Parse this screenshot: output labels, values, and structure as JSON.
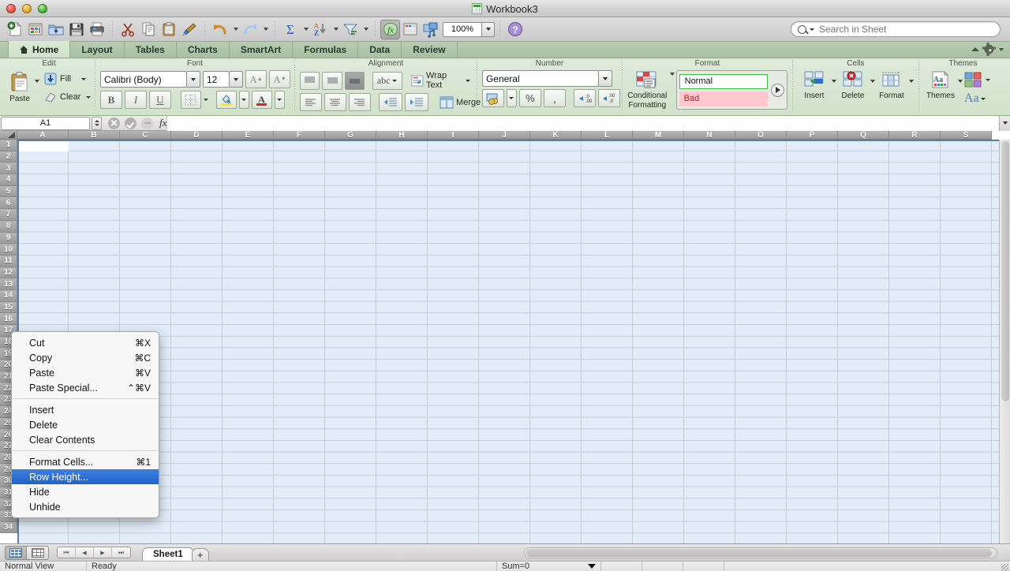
{
  "window": {
    "title": "Workbook3",
    "traffic_lights": [
      "close",
      "minimize",
      "zoom"
    ]
  },
  "standard_toolbar": {
    "buttons": [
      {
        "name": "new-workbook",
        "icon": "new-document-icon"
      },
      {
        "name": "open-template",
        "icon": "template-gallery-icon"
      },
      {
        "name": "open",
        "icon": "open-folder-icon"
      },
      {
        "name": "save",
        "icon": "save-disk-icon"
      },
      {
        "name": "print",
        "icon": "printer-icon"
      },
      {
        "name": "cut",
        "icon": "scissors-icon"
      },
      {
        "name": "copy",
        "icon": "copy-icon"
      },
      {
        "name": "paste",
        "icon": "clipboard-icon"
      },
      {
        "name": "format-painter",
        "icon": "paintbrush-icon"
      },
      {
        "name": "undo",
        "icon": "undo-arrow-icon"
      },
      {
        "name": "redo",
        "icon": "redo-arrow-icon"
      },
      {
        "name": "autosum",
        "icon": "sigma-icon"
      },
      {
        "name": "sort",
        "icon": "sort-az-icon"
      },
      {
        "name": "filter",
        "icon": "funnel-icon"
      },
      {
        "name": "formula-builder",
        "icon": "fx-icon"
      },
      {
        "name": "toolbox",
        "icon": "toolbox-icon"
      },
      {
        "name": "media-browser",
        "icon": "media-browser-icon"
      },
      {
        "name": "help",
        "icon": "help-question-icon"
      }
    ],
    "zoom_value": "100%",
    "search_placeholder": "Search in Sheet",
    "search_value": ""
  },
  "ribbon_tabs": {
    "items": [
      {
        "label": "Home",
        "active": true,
        "icon": "home-icon"
      },
      {
        "label": "Layout",
        "active": false
      },
      {
        "label": "Tables",
        "active": false
      },
      {
        "label": "Charts",
        "active": false
      },
      {
        "label": "SmartArt",
        "active": false
      },
      {
        "label": "Formulas",
        "active": false
      },
      {
        "label": "Data",
        "active": false
      },
      {
        "label": "Review",
        "active": false
      }
    ]
  },
  "ribbon": {
    "groups": [
      {
        "name": "edit",
        "label": "Edit"
      },
      {
        "name": "font",
        "label": "Font"
      },
      {
        "name": "alignment",
        "label": "Alignment"
      },
      {
        "name": "number",
        "label": "Number"
      },
      {
        "name": "format",
        "label": "Format"
      },
      {
        "name": "cells",
        "label": "Cells"
      },
      {
        "name": "themes",
        "label": "Themes"
      }
    ],
    "edit": {
      "paste_label": "Paste",
      "fill_label": "Fill",
      "clear_label": "Clear"
    },
    "font": {
      "family_value": "Calibri (Body)",
      "size_value": "12",
      "grow_label": "A",
      "shrink_label": "A",
      "bold_label": "B",
      "italic_label": "I",
      "underline_label": "U"
    },
    "alignment": {
      "orientation_label": "abc",
      "wrap_text_label": "Wrap Text",
      "merge_label": "Merge"
    },
    "number": {
      "format_value": "General",
      "percent_label": "%",
      "comma_label": ","
    },
    "format": {
      "conditional_label_line1": "Conditional",
      "conditional_label_line2": "Formatting",
      "styles": [
        {
          "label": "Normal",
          "kind": "normal"
        },
        {
          "label": "Bad",
          "kind": "bad"
        }
      ]
    },
    "cells": {
      "insert_label": "Insert",
      "delete_label": "Delete",
      "format_label": "Format"
    },
    "themes": {
      "themes_label": "Themes",
      "fonts_label": "Aa"
    }
  },
  "formula_bar": {
    "name_box_value": "A1",
    "formula_value": "",
    "cancel_icon": "cancel-circle-icon",
    "enter_icon": "check-circle-icon",
    "fx_label": "fx"
  },
  "sheet": {
    "columns": [
      "A",
      "B",
      "C",
      "D",
      "E",
      "F",
      "G",
      "H",
      "I",
      "J",
      "K",
      "L",
      "M",
      "N",
      "O",
      "P",
      "Q",
      "R",
      "S"
    ],
    "rows": [
      1,
      2,
      3,
      4,
      5,
      6,
      7,
      8,
      9,
      10,
      11,
      12,
      13,
      14,
      15,
      16,
      17,
      18,
      19,
      20,
      21,
      22,
      23,
      24,
      25,
      26,
      27,
      28,
      29,
      30,
      31,
      32,
      33,
      34
    ],
    "active_cell": "A1",
    "selection": "entire-sheet"
  },
  "context_menu": {
    "groups": [
      [
        {
          "label": "Cut",
          "shortcut": "⌘X",
          "selected": false
        },
        {
          "label": "Copy",
          "shortcut": "⌘C",
          "selected": false
        },
        {
          "label": "Paste",
          "shortcut": "⌘V",
          "selected": false
        },
        {
          "label": "Paste Special...",
          "shortcut": "⌃⌘V",
          "selected": false
        }
      ],
      [
        {
          "label": "Insert",
          "shortcut": "",
          "selected": false
        },
        {
          "label": "Delete",
          "shortcut": "",
          "selected": false
        },
        {
          "label": "Clear Contents",
          "shortcut": "",
          "selected": false
        }
      ],
      [
        {
          "label": "Format Cells...",
          "shortcut": "⌘1",
          "selected": false
        },
        {
          "label": "Row Height...",
          "shortcut": "",
          "selected": true
        },
        {
          "label": "Hide",
          "shortcut": "",
          "selected": false
        },
        {
          "label": "Unhide",
          "shortcut": "",
          "selected": false
        }
      ]
    ]
  },
  "sheet_bar": {
    "tabs": [
      {
        "label": "Sheet1",
        "active": true
      }
    ],
    "add_tab_label": "+",
    "nav_first": "⏮",
    "nav_prev": "◀",
    "nav_next": "▶",
    "nav_last": "⏭"
  },
  "status_bar": {
    "view_label": "Normal View",
    "state_label": "Ready",
    "sum_label": "Sum=0"
  },
  "colors": {
    "accent_blue": "#1f63c9",
    "ribbon_green": "#d2e2cb",
    "grid_selection": "#e3edf9",
    "bad_style_bg": "#ffc7ce",
    "bad_style_fg": "#b5222a",
    "normal_style_border": "#3fbf3f"
  }
}
